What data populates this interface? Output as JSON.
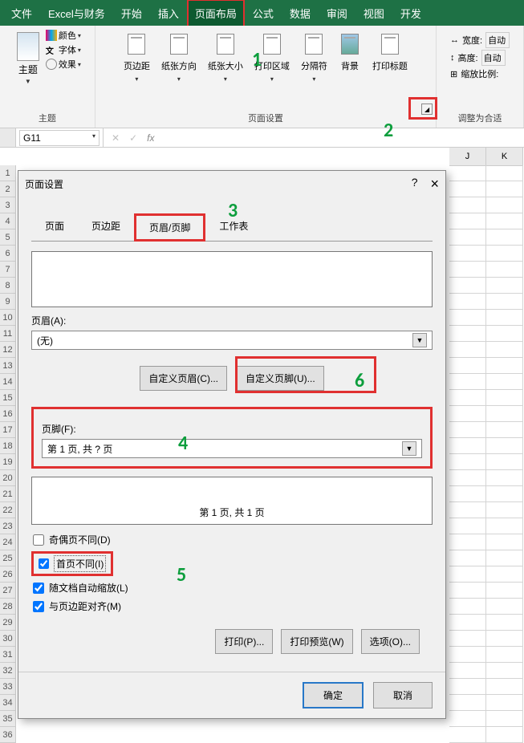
{
  "menu": [
    "文件",
    "Excel与财务",
    "开始",
    "插入",
    "页面布局",
    "公式",
    "数据",
    "审阅",
    "视图",
    "开发"
  ],
  "menu_active_index": 4,
  "ribbon": {
    "theme_group": {
      "title": "主题",
      "btn_theme": "主题",
      "opt_color": "颜色",
      "opt_font": "字体",
      "opt_effect": "效果"
    },
    "page_setup_group": {
      "title": "页面设置",
      "btn_margins": "页边距",
      "btn_orientation": "纸张方向",
      "btn_size": "纸张大小",
      "btn_print_area": "打印区域",
      "btn_breaks": "分隔符",
      "btn_background": "背景",
      "btn_print_titles": "打印标题"
    },
    "scale_group": {
      "title": "调整为合适",
      "label_width": "宽度:",
      "label_height": "高度:",
      "label_scale": "缩放比例:",
      "val_auto": "自动"
    }
  },
  "name_box": "G11",
  "fx_label": "fx",
  "col_headers": [
    "J",
    "K"
  ],
  "annotations": {
    "a1": "1",
    "a2": "2",
    "a3": "3",
    "a4": "4",
    "a5": "5",
    "a6": "6"
  },
  "dialog": {
    "title": "页面设置",
    "help": "?",
    "close": "×",
    "tabs": [
      "页面",
      "页边距",
      "页眉/页脚",
      "工作表"
    ],
    "active_tab_index": 2,
    "label_header": "页眉(A):",
    "dropdown_header_value": "(无)",
    "btn_custom_header": "自定义页眉(C)...",
    "btn_custom_footer": "自定义页脚(U)...",
    "label_footer": "页脚(F):",
    "dropdown_footer_value": "第 1 页, 共 ? 页",
    "footer_preview_text": "第 1 页, 共 1 页",
    "chk_odd_even": "奇偶页不同(D)",
    "chk_first_page": "首页不同(I)",
    "chk_scale_doc": "随文档自动缩放(L)",
    "chk_align_margin": "与页边距对齐(M)",
    "btn_print": "打印(P)...",
    "btn_print_preview": "打印预览(W)",
    "btn_options": "选项(O)...",
    "btn_ok": "确定",
    "btn_cancel": "取消"
  }
}
